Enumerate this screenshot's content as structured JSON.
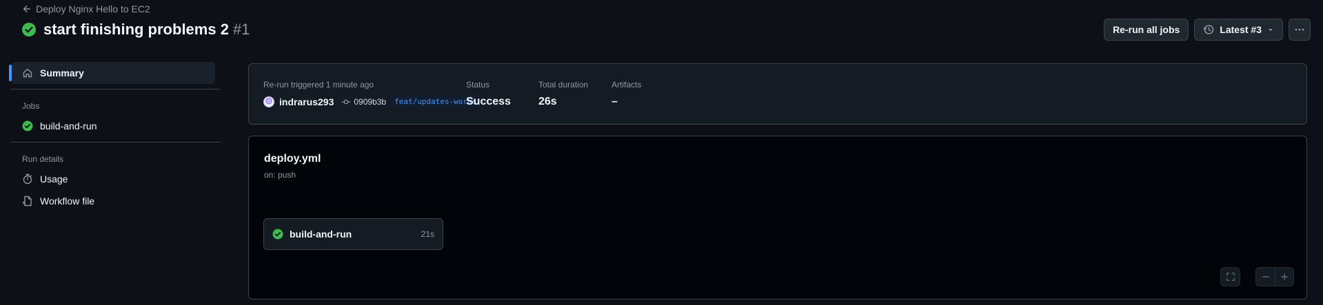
{
  "header": {
    "back_label": "Deploy Nginx Hello to EC2",
    "title": "start finishing problems 2",
    "run_number": "#1",
    "rerun_label": "Re-run all jobs",
    "attempt_label": "Latest #3"
  },
  "sidebar": {
    "summary_label": "Summary",
    "jobs_heading": "Jobs",
    "jobs": [
      {
        "label": "build-and-run",
        "status": "success"
      }
    ],
    "run_details_heading": "Run details",
    "usage_label": "Usage",
    "workflow_file_label": "Workflow file"
  },
  "summary": {
    "trigger_text": "Re-run triggered 1 minute ago",
    "user": "indrarus293",
    "commit": "0909b3b",
    "branch": "feat/updates-works",
    "status_label": "Status",
    "status_value": "Success",
    "duration_label": "Total duration",
    "duration_value": "26s",
    "artifacts_label": "Artifacts",
    "artifacts_value": "–"
  },
  "workflow": {
    "file": "deploy.yml",
    "trigger": "on: push",
    "job": {
      "name": "build-and-run",
      "duration": "21s"
    }
  },
  "colors": {
    "success": "#3fb950",
    "accent": "#4493f8",
    "background": "#0d1117"
  }
}
